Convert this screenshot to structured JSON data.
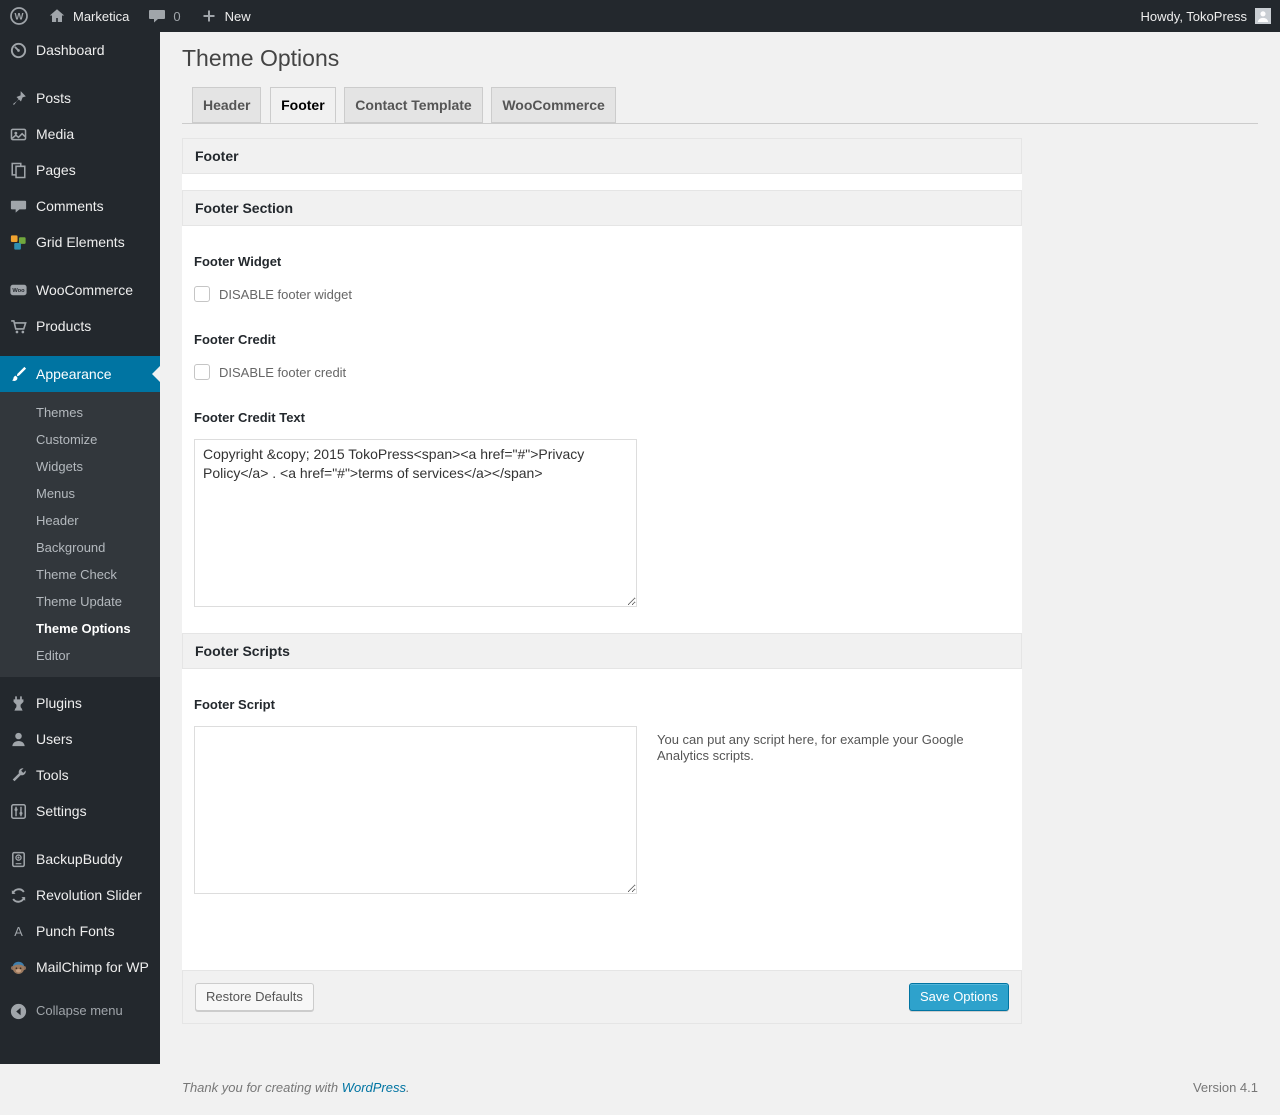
{
  "admin_bar": {
    "site_name": "Marketica",
    "comments_count": "0",
    "new_label": "New",
    "howdy": "Howdy, TokoPress"
  },
  "sidebar": {
    "menu": {
      "dashboard": "Dashboard",
      "posts": "Posts",
      "media": "Media",
      "pages": "Pages",
      "comments": "Comments",
      "grid_elements": "Grid Elements",
      "woocommerce": "WooCommerce",
      "products": "Products",
      "appearance": "Appearance",
      "plugins": "Plugins",
      "users": "Users",
      "tools": "Tools",
      "settings": "Settings",
      "backupbuddy": "BackupBuddy",
      "revolution_slider": "Revolution Slider",
      "punch_fonts": "Punch Fonts",
      "mailchimp": "MailChimp for WP",
      "collapse": "Collapse menu"
    },
    "appearance_submenu": [
      "Themes",
      "Customize",
      "Widgets",
      "Menus",
      "Header",
      "Background",
      "Theme Check",
      "Theme Update",
      "Theme Options",
      "Editor"
    ],
    "active_item": "Appearance",
    "active_submenu_item": "Theme Options"
  },
  "page": {
    "title": "Theme Options",
    "tabs": [
      {
        "label": "Header",
        "active": false
      },
      {
        "label": "Footer",
        "active": true
      },
      {
        "label": "Contact Template",
        "active": false
      },
      {
        "label": "WooCommerce",
        "active": false
      }
    ]
  },
  "panel": {
    "header": "Footer",
    "footer_section_title": "Footer Section",
    "fields": {
      "footer_widget": {
        "label": "Footer Widget",
        "checkbox_label": "DISABLE footer widget",
        "checked": false
      },
      "footer_credit": {
        "label": "Footer Credit",
        "checkbox_label": "DISABLE footer credit",
        "checked": false
      },
      "footer_credit_text": {
        "label": "Footer Credit Text",
        "value": "Copyright &copy; 2015 TokoPress<span><a href=\"#\">Privacy Policy</a> . <a href=\"#\">terms of services</a></span>"
      }
    },
    "scripts_section_title": "Footer Scripts",
    "footer_script": {
      "label": "Footer Script",
      "value": "",
      "description": "You can put any script here, for example your Google Analytics scripts."
    },
    "buttons": {
      "restore": "Restore Defaults",
      "save": "Save Options"
    }
  },
  "footer": {
    "thanks_prefix": "Thank you for creating with ",
    "wordpress_link": "WordPress",
    "thanks_suffix": ".",
    "version": "Version 4.1"
  },
  "colors": {
    "admin_bar_bg": "#23282d",
    "submenu_bg": "#32373c",
    "accent_blue": "#0074a2",
    "primary_button": "#2ea2cc",
    "page_bg": "#f1f1f1",
    "panel_bar_bg": "#f1f1f1"
  },
  "icons": {
    "wordpress-logo-icon": "W in ring",
    "home-icon": "house",
    "comments-bubble-icon": "speech bubble",
    "plus-icon": "+",
    "dashboard-icon": "gauge",
    "posts-icon": "pushpin",
    "media-icon": "photo",
    "pages-icon": "stacked pages",
    "grid-elements-icon": "three colored tiles",
    "woocommerce-icon": "Woo badge",
    "products-icon": "shopping cart",
    "appearance-icon": "paint brush",
    "plugins-icon": "power plug",
    "users-icon": "person",
    "tools-icon": "wrench",
    "settings-icon": "sliders",
    "backupbuddy-icon": "backup drive",
    "revolution-slider-icon": "circular arrows",
    "punch-fonts-icon": "letter A",
    "mailchimp-icon": "monkey face",
    "collapse-icon": "left arrow circle",
    "avatar": "person square"
  }
}
